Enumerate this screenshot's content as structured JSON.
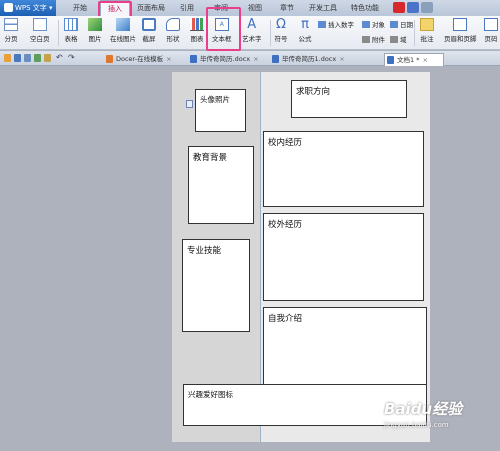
{
  "app": {
    "name": "WPS 文字"
  },
  "menu": {
    "tabs": [
      "开始",
      "插入",
      "页面布局",
      "引用",
      "审阅",
      "视图",
      "章节",
      "开发工具",
      "特色功能"
    ],
    "active": "插入"
  },
  "ribbon": {
    "page_break": "分页",
    "blank_page": "空白页",
    "table": "表格",
    "picture": "图片",
    "online_picture": "在线图片",
    "screenshot": "截屏",
    "shape": "形状",
    "chart": "图表",
    "textbox": "文本框",
    "wordart": "艺术字",
    "symbol": "符号",
    "formula": "公式",
    "insert_number": "插入数字",
    "object": "对象",
    "date": "日期",
    "attachment": "附件",
    "domain": "域",
    "comment": "批注",
    "header_footer": "页眉和页脚",
    "page_number": "页码"
  },
  "doc_tabs": [
    {
      "label": "Docer-在线模板",
      "closable": true
    },
    {
      "label": "毕传奇简历.docx",
      "closable": true
    },
    {
      "label": "毕传奇简历1.docx",
      "closable": true
    },
    {
      "label": "文档1 *",
      "closable": true,
      "active": true
    }
  ],
  "document": {
    "photo": "头像照片",
    "job_direction": "求职方向",
    "education": "教育背景",
    "campus_experience": "校内经历",
    "off_campus_experience": "校外经历",
    "skills": "专业技能",
    "self_intro": "自我介绍",
    "hobbies": "兴趣爱好图标"
  },
  "watermark": {
    "brand": "Baidu经验",
    "url": "jingyan.baidu.com"
  },
  "colors": {
    "highlight": "#ea3e8a",
    "app_blue": "#1d5fb3"
  }
}
